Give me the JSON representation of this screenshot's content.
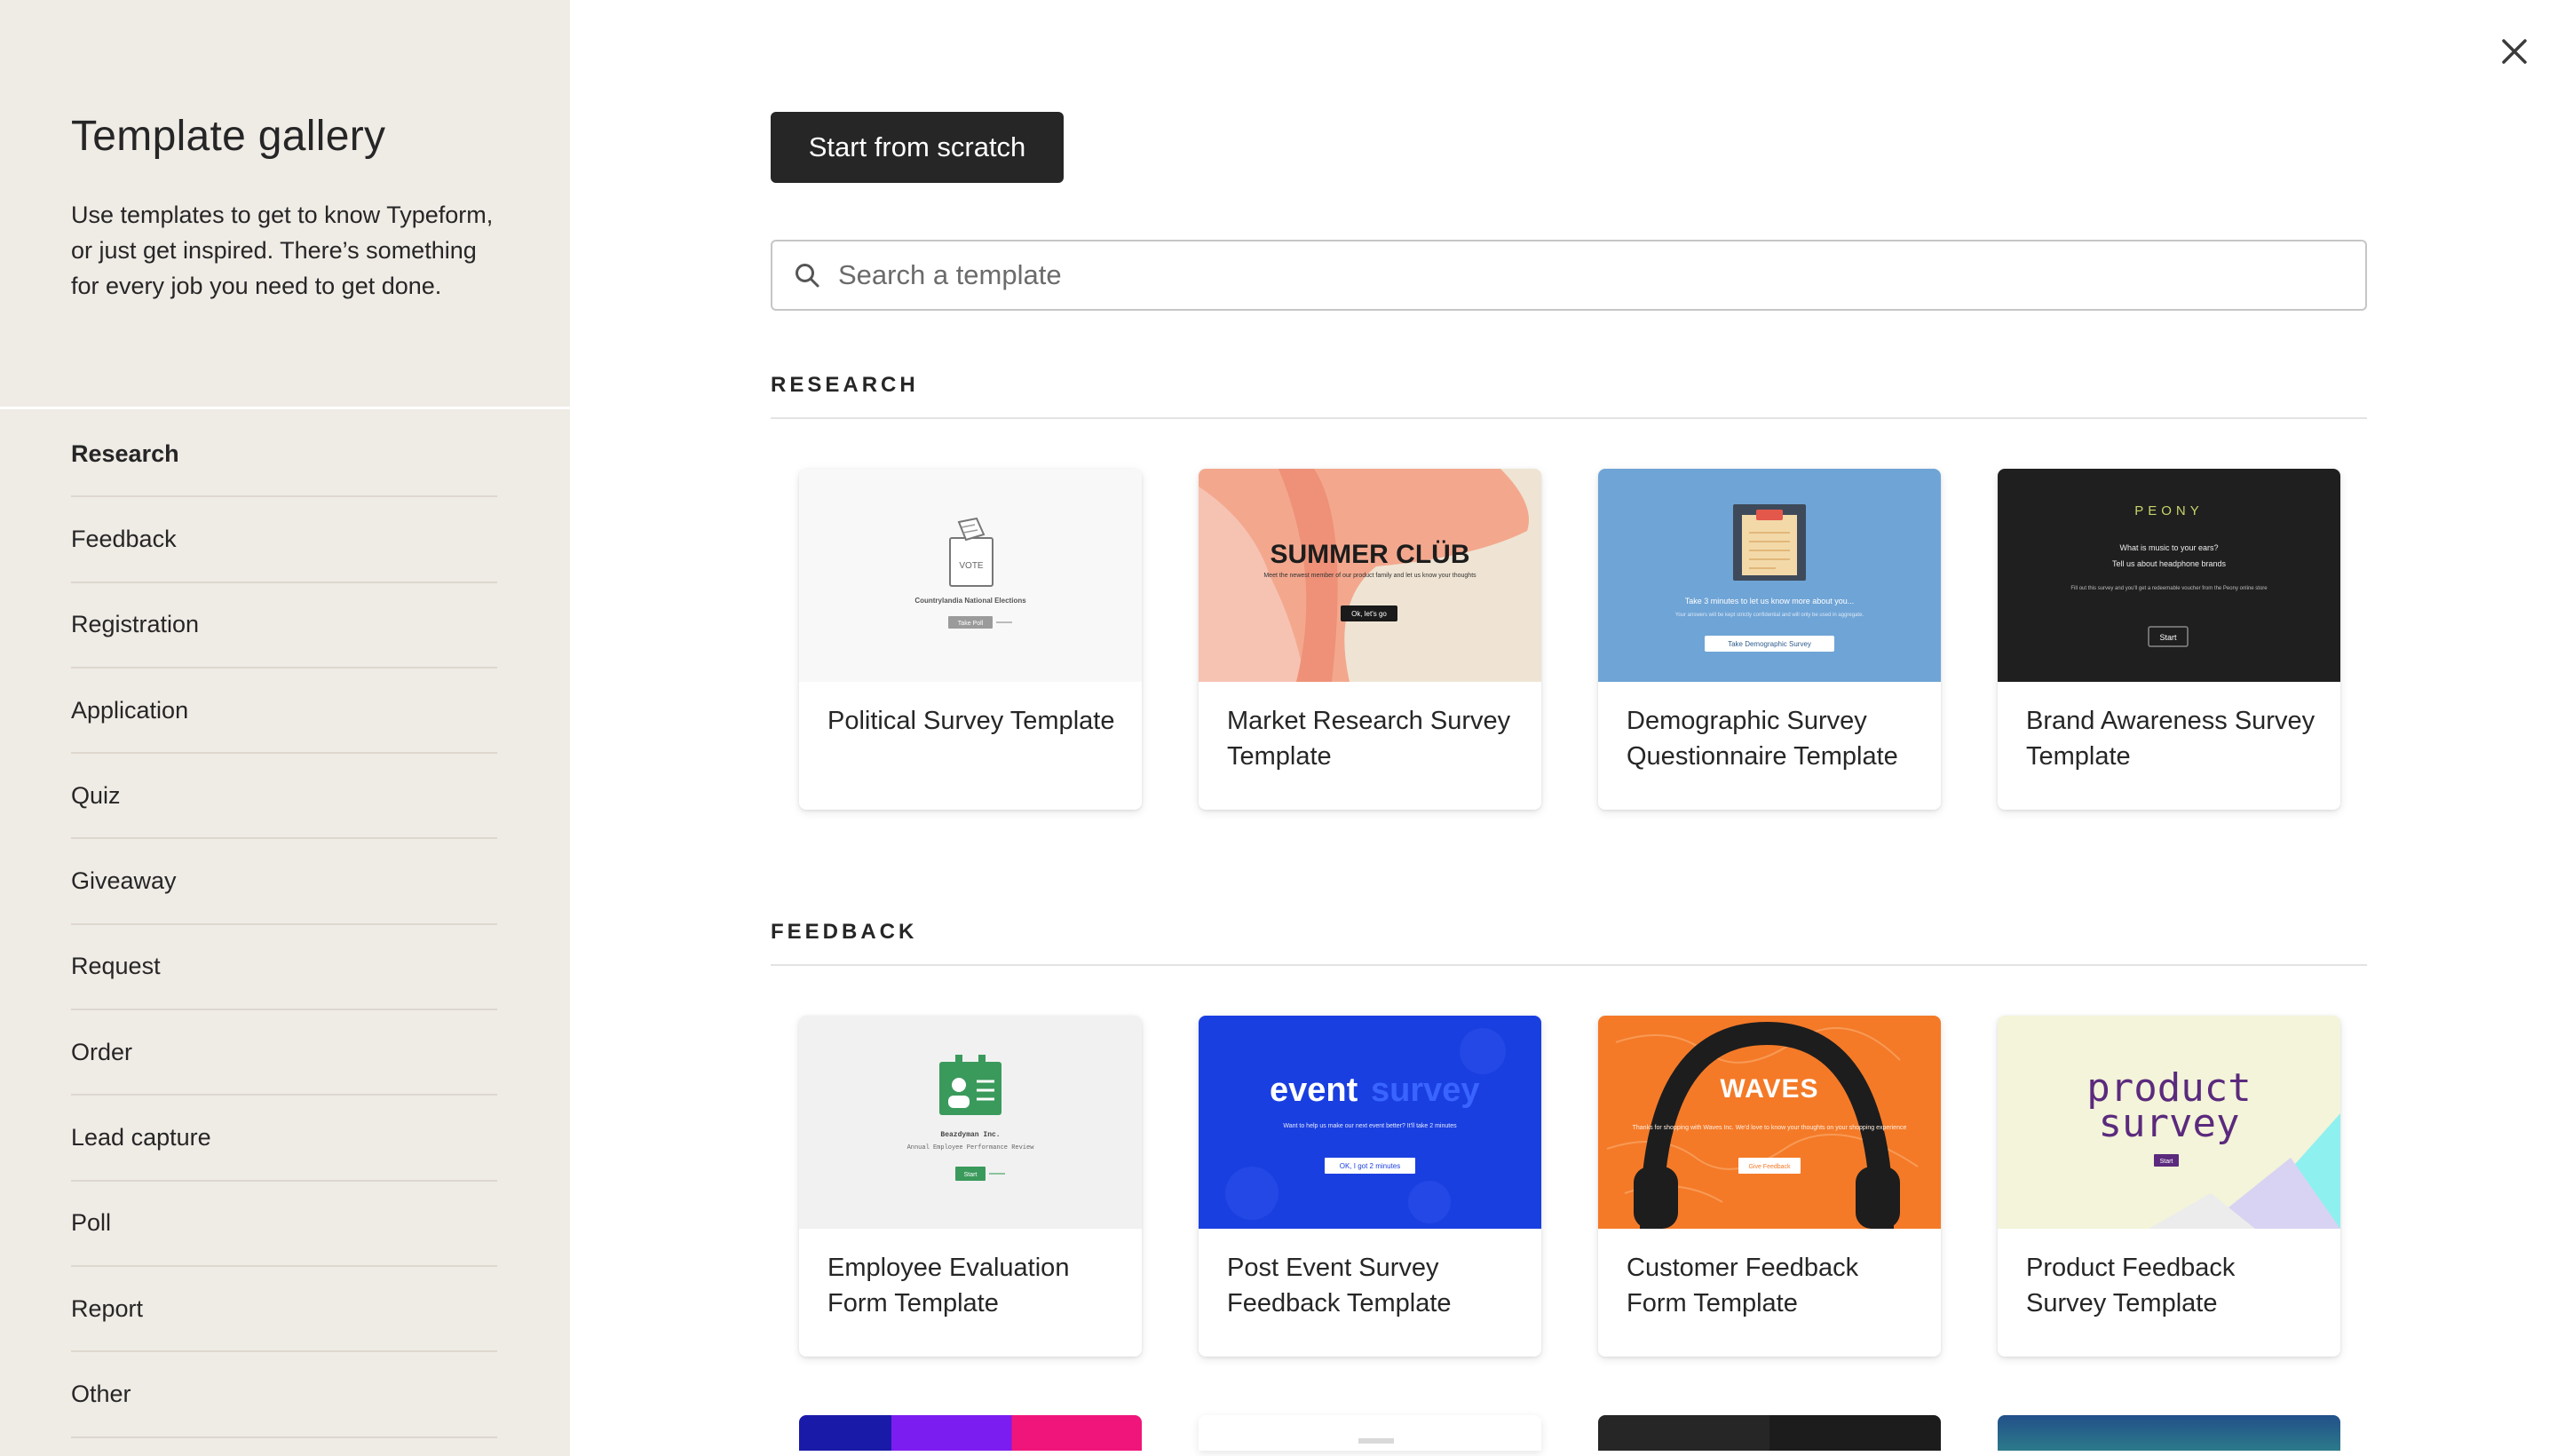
{
  "sidebar": {
    "title": "Template gallery",
    "description": "Use templates to get to know Typeform, or just get inspired. There’s something for every job you need to get done.",
    "items": [
      {
        "label": "Research",
        "active": true
      },
      {
        "label": "Feedback"
      },
      {
        "label": "Registration"
      },
      {
        "label": "Application"
      },
      {
        "label": "Quiz"
      },
      {
        "label": "Giveaway"
      },
      {
        "label": "Request"
      },
      {
        "label": "Order"
      },
      {
        "label": "Lead capture"
      },
      {
        "label": "Poll"
      },
      {
        "label": "Report"
      },
      {
        "label": "Other"
      }
    ]
  },
  "main": {
    "scratch_label": "Start from scratch",
    "search": {
      "placeholder": "Search a template",
      "value": ""
    },
    "sections": [
      {
        "heading": "RESEARCH",
        "cards": [
          {
            "title": "Political Survey Template",
            "thumb": {
              "vote_label": "VOTE",
              "caption": "Countrylandia National Elections",
              "button": "Take Poll"
            }
          },
          {
            "title": "Market Research Survey Template",
            "thumb": {
              "heading": "SUMMER CLÜB",
              "sub": "Meet the newest member of our product family and let us know your thoughts",
              "button": "Ok, let's go"
            }
          },
          {
            "title": "Demographic Survey Questionnaire Template",
            "thumb": {
              "line1": "Take 3 minutes to let us know more about you...",
              "line2": "Your answers will be kept strictly confidential and will only be used in aggregate.",
              "button": "Take Demographic Survey"
            }
          },
          {
            "title": "Brand Awareness Survey Template",
            "thumb": {
              "brand": "PEONY",
              "line1": "What is music to your ears?",
              "line2": "Tell us about headphone brands",
              "line3": "Fill out this survey and you'll get a redeemable voucher from the Peony online store",
              "button": "Start"
            }
          }
        ]
      },
      {
        "heading": "FEEDBACK",
        "cards": [
          {
            "title": "Employee Evaluation Form Template",
            "thumb": {
              "company": "Beazdyman Inc.",
              "caption": "Annual Employee Performance Review",
              "button": "Start"
            }
          },
          {
            "title": "Post Event Survey Feedback Template",
            "thumb": {
              "word1": "event",
              "word2": "survey",
              "sub": "Want to help us make our next event better? It'll take 2 minutes",
              "button": "OK, I got 2 minutes"
            }
          },
          {
            "title": "Customer Feedback Form Template",
            "thumb": {
              "brand": "WAVES",
              "sub": "Thanks for shopping with Waves Inc. We'd love to know your thoughts on your shopping experience",
              "button": "Give Feedback"
            }
          },
          {
            "title": "Product Feedback Survey Template",
            "thumb": {
              "word1": "product",
              "word2": "survey",
              "button": "Start"
            }
          }
        ]
      }
    ]
  },
  "colors": {
    "sidebar_bg": "#efebe5",
    "dark_button": "#262627",
    "employee_green": "#3a9a5b",
    "event_blue": "#1a3fe0",
    "waves_orange": "#f47a28",
    "demographic_blue": "#6fa4d6"
  },
  "icons": {
    "close": "close-icon",
    "search": "search-icon"
  }
}
